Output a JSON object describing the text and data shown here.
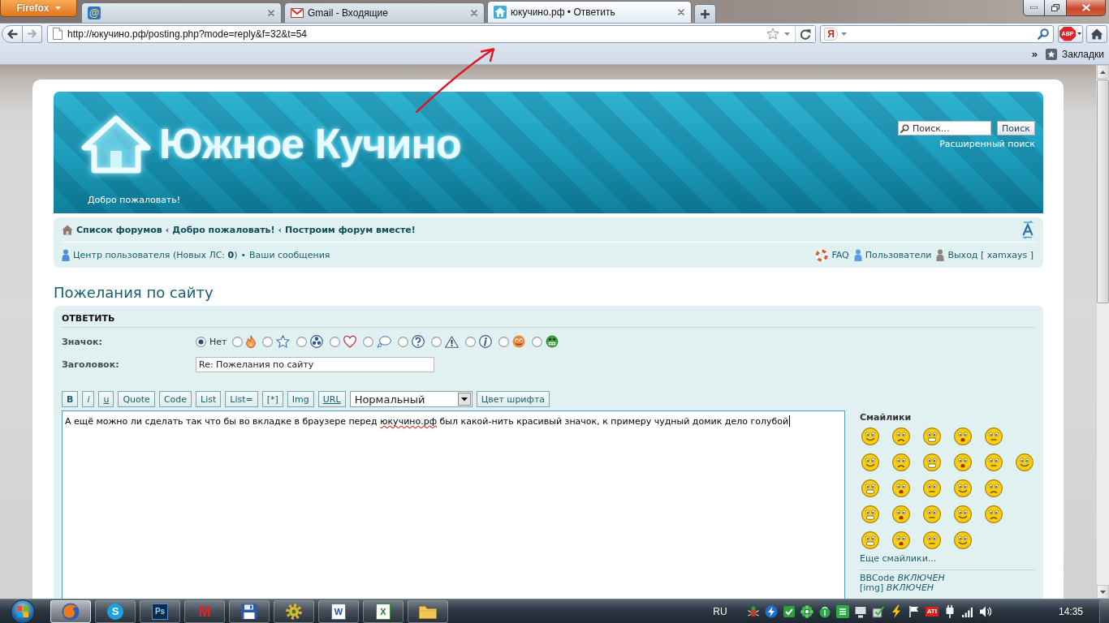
{
  "browser": {
    "menu_button": {
      "label": "Firefox"
    },
    "tabs": [
      {
        "kind": "at",
        "glyph": "@",
        "selected": false
      },
      {
        "kind": "envelope",
        "title": "Gmail - Входящие",
        "selected": false
      },
      {
        "kind": "house",
        "title": "юкучино.рф • Ответить",
        "selected": true
      }
    ],
    "address": {
      "value": "http://юкучино.рф/posting.php?mode=reply&f=32&t=54"
    },
    "search": {
      "engine_glyph": "Я"
    },
    "addon_badge": "ABP",
    "bookmarks": {
      "overflow": "»",
      "label": "Закладки"
    }
  },
  "forum": {
    "logo_title": "Южное Кучино",
    "welcome": "Добро пожаловать!",
    "search": {
      "placeholder": "Поиск…",
      "button": "Поиск",
      "advanced_link": "Расширенный поиск"
    },
    "breadcrumbs": [
      {
        "label": "Список форумов"
      },
      {
        "separator": "‹",
        "label": "Добро пожаловать!"
      },
      {
        "separator": "‹",
        "label": "Построим форум вместе!"
      }
    ],
    "user_links": [
      {
        "kind": "user",
        "text": "Центр пользователя (Новых ЛС: **0**)"
      },
      {
        "separator": "•",
        "text": "Ваши сообщения"
      }
    ],
    "right_links": [
      {
        "kind": "faq",
        "text": "FAQ"
      },
      {
        "kind": "users",
        "text": "Пользователи"
      },
      {
        "kind": "logout",
        "text": "Выход [ xamxays ]"
      }
    ],
    "page_title": "Пожелания по сайту",
    "form": {
      "heading": "ОТВЕТИТЬ",
      "icon_label": "Значок:",
      "icon_options": [
        {
          "kind": "none",
          "label": "Нет",
          "selected": true
        },
        {
          "kind": "fire",
          "selected": false
        },
        {
          "kind": "star",
          "selected": false
        },
        {
          "kind": "radiation",
          "selected": false
        },
        {
          "kind": "heart",
          "selected": false
        },
        {
          "kind": "thought",
          "selected": false
        },
        {
          "kind": "question",
          "selected": false
        },
        {
          "kind": "warning",
          "selected": false
        },
        {
          "kind": "info",
          "selected": false
        },
        {
          "kind": "wink",
          "selected": false
        },
        {
          "kind": "grin",
          "selected": false
        }
      ],
      "subject_label": "Заголовок:",
      "subject": {
        "value": "Re: Пожелания по сайту"
      },
      "toolbar": [
        {
          "kind": "bold",
          "label": "B"
        },
        {
          "kind": "italic",
          "label": "i"
        },
        {
          "kind": "underline",
          "label": "u"
        },
        {
          "kind": "plain",
          "label": "Quote"
        },
        {
          "kind": "plain",
          "label": "Code"
        },
        {
          "kind": "plain",
          "label": "List"
        },
        {
          "kind": "plain",
          "label": "List="
        },
        {
          "kind": "plain",
          "label": "[*]"
        },
        {
          "kind": "plain",
          "label": "Img"
        },
        {
          "kind": "underline",
          "label": "URL"
        },
        {
          "kind": "select",
          "value": "Нормальный"
        },
        {
          "kind": "plain",
          "label": "Цвет шрифта"
        }
      ],
      "message": {
        "focused": true,
        "parts": [
          {
            "text": "А ещё можно ли сделать так что бы во вкладке в браузере перед ",
            "misspelled": false
          },
          {
            "text": "юкучино.рф",
            "misspelled": true
          },
          {
            "text": " был какой-нить красивый значок, к примеру чудный домик дело голубой",
            "misspelled": false
          }
        ]
      },
      "smilies": {
        "title": "Смайлики",
        "more_link": "Еще смайлики...",
        "status": [
          "BBCode *ВКЛЮЧЕН*",
          "[img] *ВКЛЮЧЕН*"
        ]
      }
    }
  },
  "taskbar": {
    "apps": [
      {
        "kind": "browser",
        "selected": true
      },
      {
        "kind": "round",
        "glyph": "S",
        "selected": false
      },
      {
        "kind": "tile",
        "glyph": "Ps",
        "selected": false
      },
      {
        "kind": "letter",
        "glyph": "M",
        "selected": false
      },
      {
        "kind": "disk",
        "selected": false
      },
      {
        "kind": "gadget",
        "selected": false
      },
      {
        "kind": "document",
        "glyph": "W",
        "selected": false
      },
      {
        "kind": "sheet",
        "glyph": "X",
        "selected": false
      },
      {
        "kind": "folder",
        "selected": false
      }
    ],
    "language": "RU",
    "tray_badge": "ATI",
    "clock": "14:35"
  }
}
